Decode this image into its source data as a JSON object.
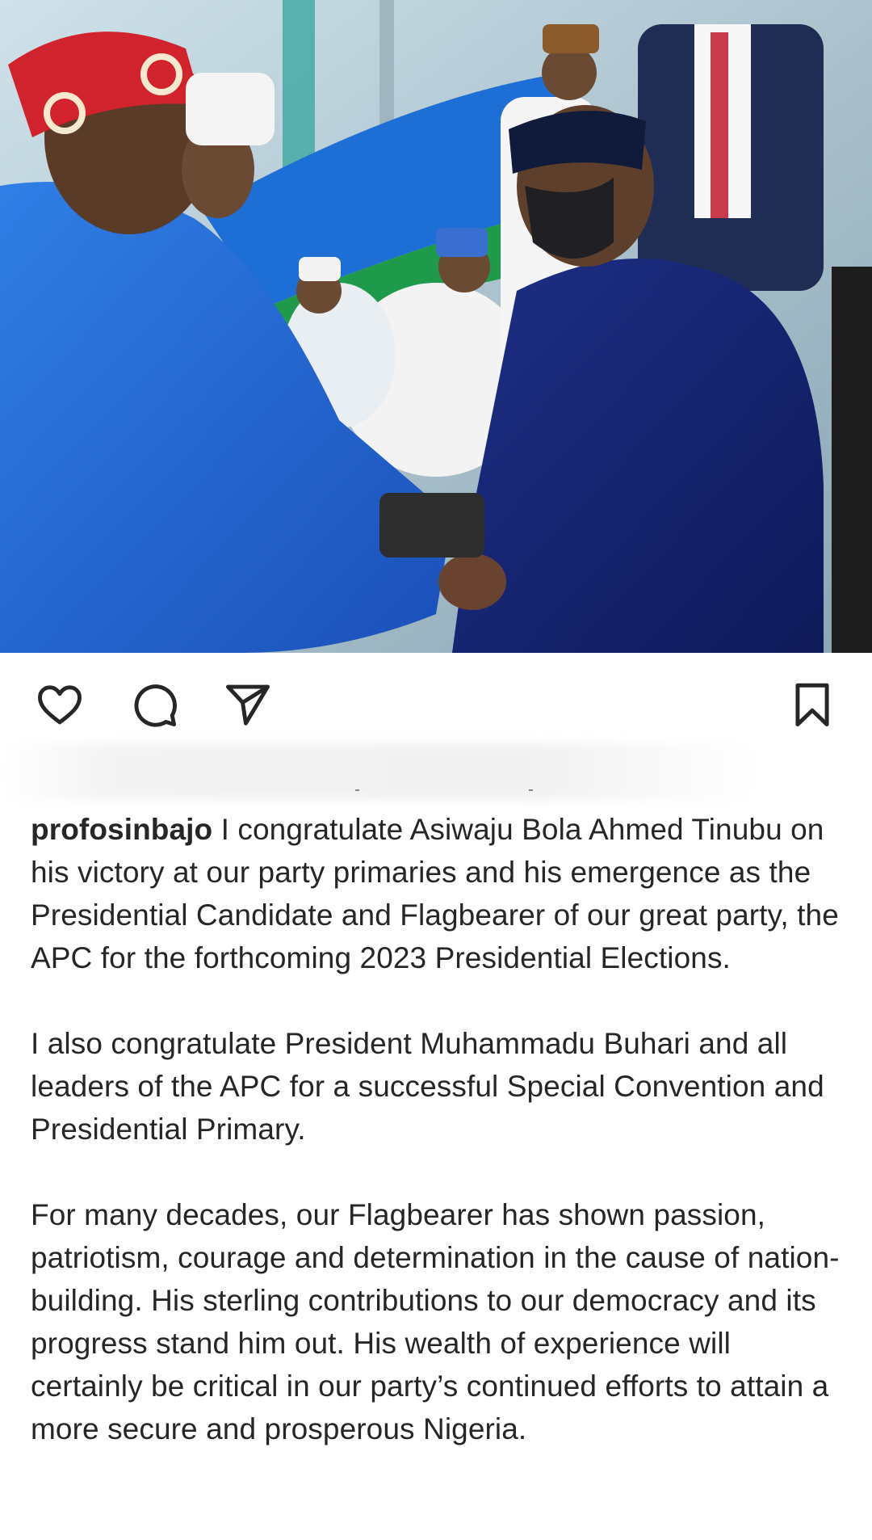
{
  "post": {
    "username": "profosinbajo",
    "paragraphs": [
      "I congratulate Asiwaju Bola Ahmed Tinubu on his victory at our party primaries and his emergence as the Presidential Candidate and Flagbearer of our great party, the APC for the forthcoming 2023 Presidential Elections.",
      "I also congratulate President Muhammadu Buhari and all leaders of the APC for a successful Special Convention and Presidential Primary.",
      "For many decades, our Flagbearer has shown passion, patriotism, courage and determination in the cause of nation-building. His sterling contributions to our democracy and its progress stand him out.  His wealth of experience will certainly be critical in our party’s continued efforts to attain a more secure and prosperous Nigeria."
    ]
  },
  "actions": {
    "like_icon": "heart-outline",
    "comment_icon": "speech-bubble",
    "share_icon": "paper-plane",
    "save_icon": "bookmark-outline"
  },
  "colors": {
    "text": "#262626",
    "background": "#ffffff"
  }
}
